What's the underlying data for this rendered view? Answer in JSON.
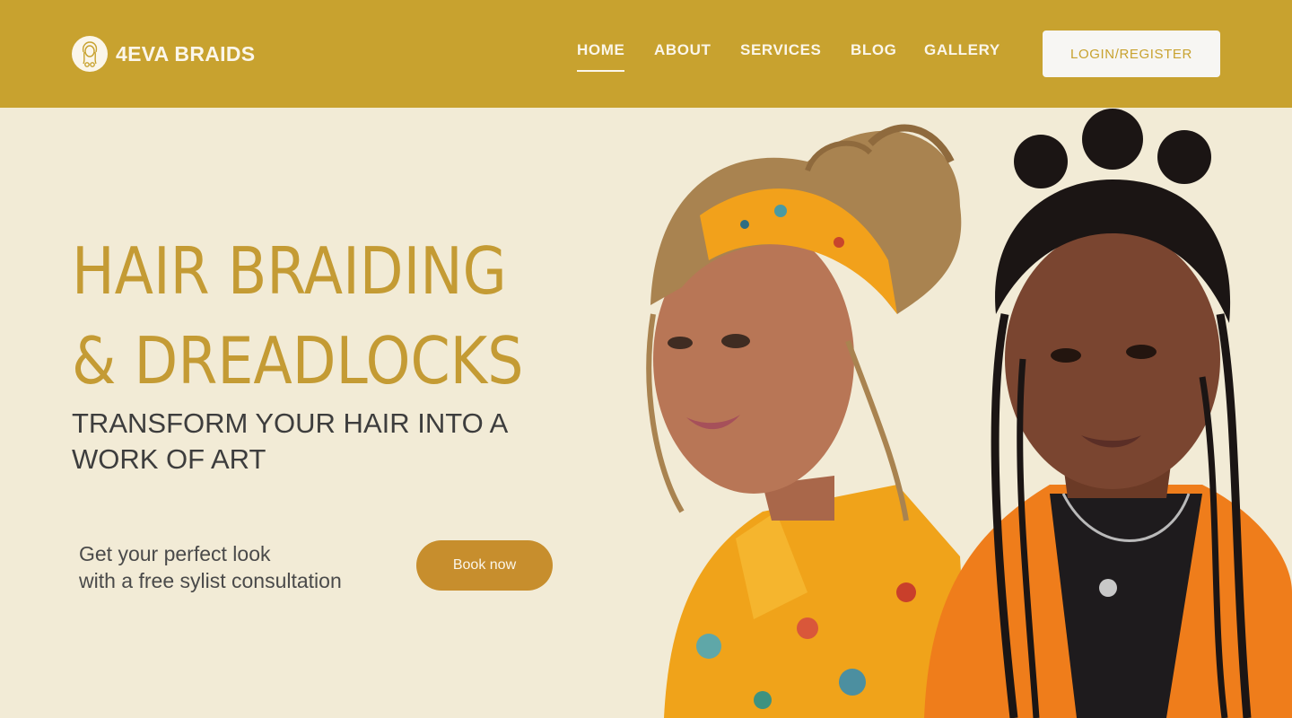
{
  "brand": {
    "name": "4EVA BRAIDS",
    "logo_icon": "braid-woman-icon"
  },
  "nav": {
    "items": [
      {
        "label": "HOME",
        "active": true
      },
      {
        "label": "ABOUT",
        "active": false
      },
      {
        "label": "SERVICES",
        "active": false
      },
      {
        "label": "BLOG",
        "active": false
      },
      {
        "label": "GALLERY",
        "active": false
      }
    ],
    "login_label": "LOGIN/REGISTER"
  },
  "hero": {
    "title_line1": "HAIR BRAIDING",
    "title_line2": "& DREADLOCKS",
    "subtitle_line1": "TRANSFORM YOUR HAIR INTO A",
    "subtitle_line2": "WORK OF ART",
    "cta_line1": "Get your perfect look",
    "cta_line2": "with a free sylist consultation",
    "book_label": "Book now"
  },
  "colors": {
    "header": "#c8a22f",
    "background": "#f2ebd6",
    "title": "#c49b34",
    "button": "#c78e2d",
    "light_text": "#fbf6ea"
  }
}
